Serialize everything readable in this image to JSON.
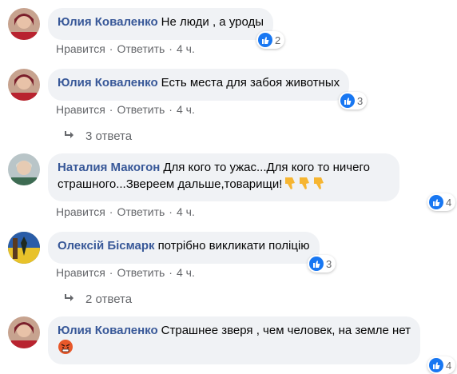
{
  "comments": [
    {
      "author": "Юлия Коваленко",
      "text": "Не люди , а уроды",
      "reactions": "2",
      "like_label": "Нравится",
      "reply_label": "Ответить",
      "time": "4 ч."
    },
    {
      "author": "Юлия Коваленко",
      "text": "Есть места для забоя животных",
      "reactions": "3",
      "like_label": "Нравится",
      "reply_label": "Ответить",
      "time": "4 ч.",
      "replies_label": "3 ответа"
    },
    {
      "author": "Наталия Макогон",
      "text_line1": "Для кого то ужас...Для кого то ничего",
      "text_line2": "страшного...Звереем дальше,товарищи!",
      "reactions": "4",
      "like_label": "Нравится",
      "reply_label": "Ответить",
      "time": "4 ч."
    },
    {
      "author": "Олексій Бісмарк",
      "text": "потрібно викликати поліцію",
      "reactions": "3",
      "like_label": "Нравится",
      "reply_label": "Ответить",
      "time": "4 ч.",
      "replies_label": "2 ответа"
    },
    {
      "author": "Юлия Коваленко",
      "text": "Страшнее зверя , чем человек, на земле нет",
      "reactions": "4"
    }
  ],
  "separator": "·",
  "colors": {
    "bubble": "#f0f2f5",
    "author": "#385898",
    "meta": "#65676b",
    "like": "#1877f2"
  }
}
